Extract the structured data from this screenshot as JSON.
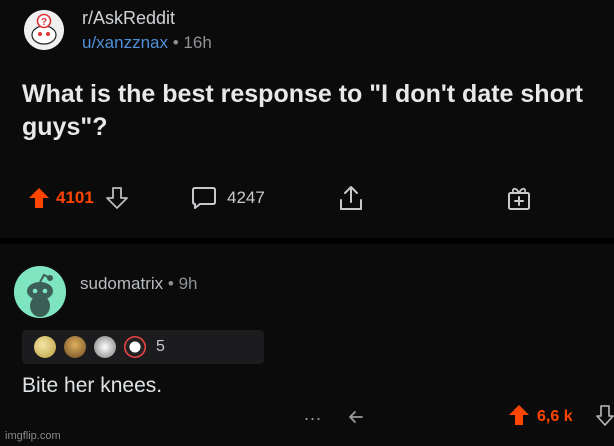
{
  "post": {
    "subreddit": "r/AskReddit",
    "username": "u/xanzznax",
    "separator": "•",
    "time": "16h",
    "title": "What is the best response to \"I don't date short guys\"?",
    "upvotes": "4101",
    "comments": "4247"
  },
  "comment": {
    "username": "sudomatrix",
    "separator": "•",
    "time": "9h",
    "award_count": "5",
    "body": "Bite her knees.",
    "more": "...",
    "score": "6,6 k"
  },
  "colors": {
    "upvote": "#ff4500",
    "username_link": "#4f8fd6",
    "avatar_bg": "#7ee5c0",
    "background": "#0b0b0c"
  },
  "icons": [
    "reddit-question-avatar-icon",
    "upvote-arrow-icon",
    "downvote-arrow-icon",
    "comment-bubble-icon",
    "share-icon",
    "gift-award-icon",
    "snoo-avatar-icon",
    "back-arrow-icon"
  ],
  "watermark": "imgflip.com"
}
